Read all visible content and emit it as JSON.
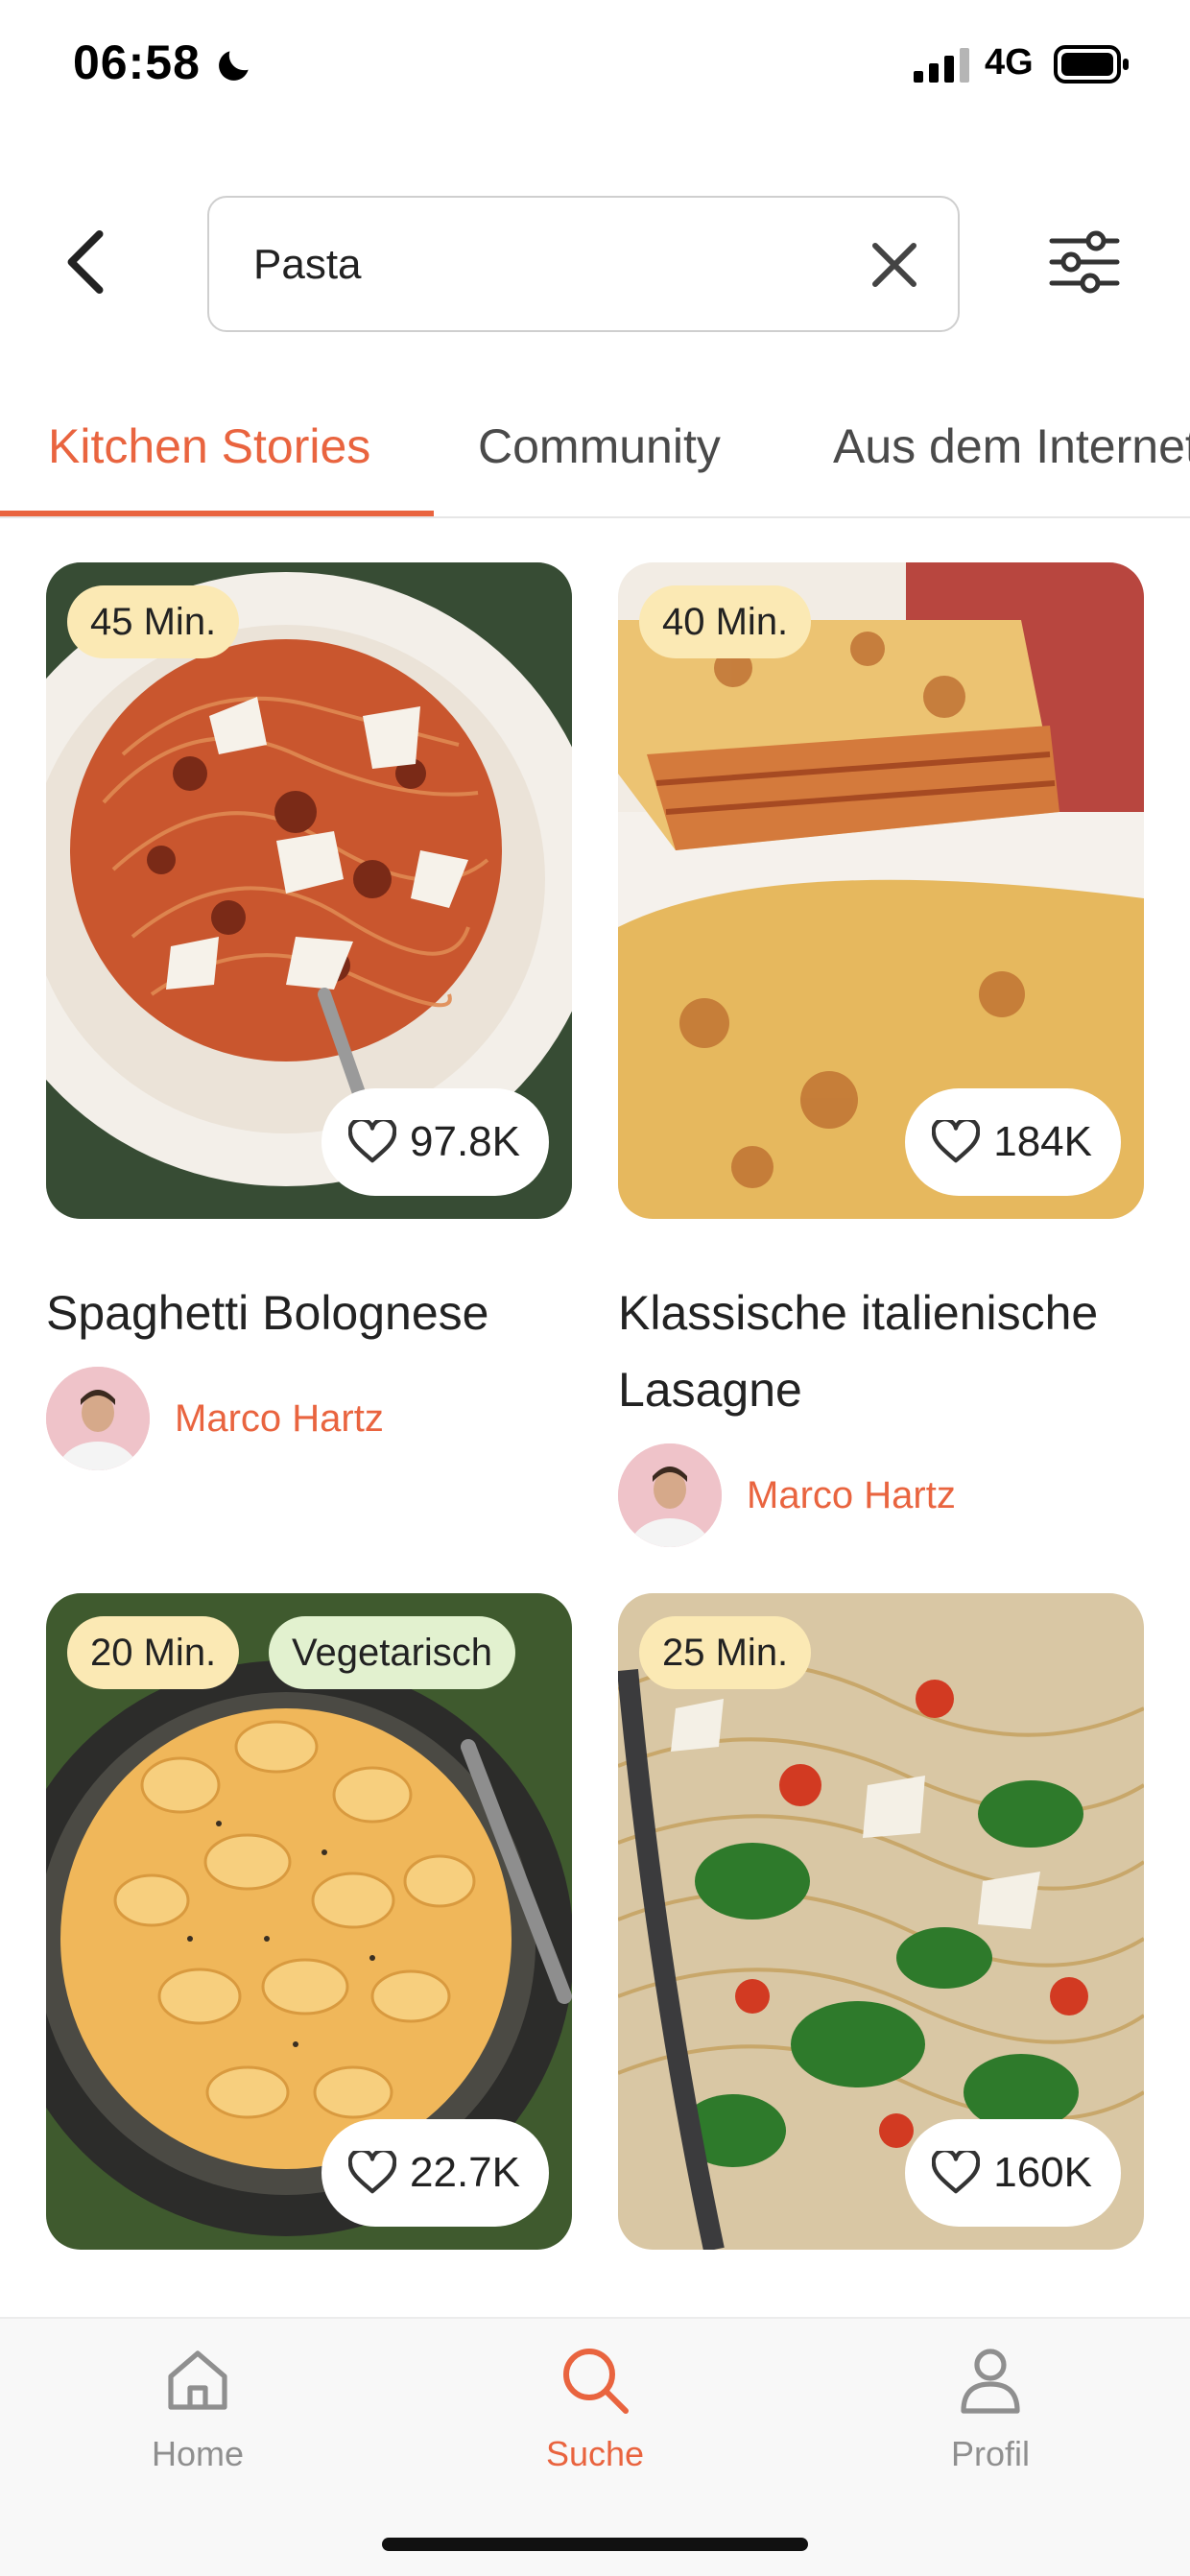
{
  "status_bar": {
    "time": "06:58",
    "network": "4G",
    "icons": [
      "moon-icon",
      "signal-icon",
      "battery-icon"
    ]
  },
  "search": {
    "value": "Pasta",
    "icons": {
      "back": "chevron-left-icon",
      "clear": "close-icon",
      "filter": "sliders-icon"
    }
  },
  "tabs": [
    {
      "label": "Kitchen Stories",
      "active": true
    },
    {
      "label": "Community",
      "active": false
    },
    {
      "label": "Aus dem Internet",
      "active": false
    }
  ],
  "recipes": [
    {
      "title": "Spaghetti Bolognese",
      "time": "45 Min.",
      "likes": "97.8K",
      "author": "Marco Hartz"
    },
    {
      "title": "Klassische italienische Lasagne",
      "time": "40 Min.",
      "likes": "184K",
      "author": "Marco Hartz"
    },
    {
      "time": "20 Min.",
      "tag": "Vegetarisch",
      "likes": "22.7K"
    },
    {
      "time": "25 Min.",
      "likes": "160K"
    }
  ],
  "bottom_nav": [
    {
      "label": "Home",
      "icon": "home-icon",
      "active": false
    },
    {
      "label": "Suche",
      "icon": "search-icon",
      "active": true
    },
    {
      "label": "Profil",
      "icon": "profile-icon",
      "active": false
    }
  ],
  "colors": {
    "accent": "#e9643f",
    "time_badge": "#fbe9b4",
    "veg_badge": "#e2f1cf",
    "inactive": "#8f8f8f"
  }
}
